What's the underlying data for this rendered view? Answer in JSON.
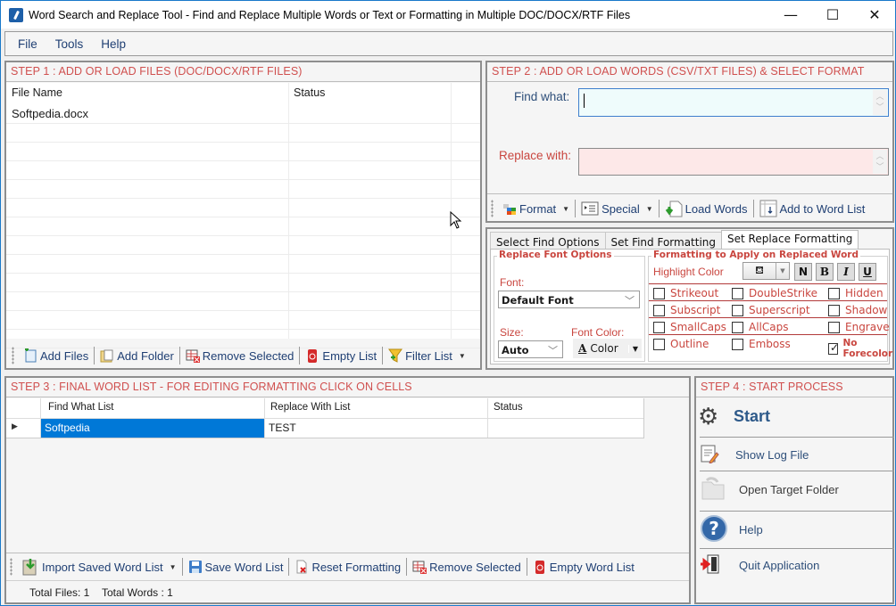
{
  "window": {
    "title": "Word Search and Replace Tool - Find and Replace Multiple Words or Text  or Formatting in Multiple DOC/DOCX/RTF Files",
    "controls": {
      "minimize": "—",
      "maximize": "☐",
      "close": "✕"
    }
  },
  "menu": [
    "File",
    "Tools",
    "Help"
  ],
  "step1": {
    "title": "STEP 1 : ADD OR LOAD FILES (DOC/DOCX/RTF FILES)",
    "columns": [
      "File Name",
      "Status"
    ],
    "rows": [
      {
        "file_name": "Softpedia.docx",
        "status": ""
      }
    ],
    "toolbar": [
      "Add Files",
      "Add Folder",
      "Remove Selected",
      "Empty List",
      "Filter List"
    ]
  },
  "step2": {
    "title": "STEP 2 : ADD OR LOAD WORDS (CSV/TXT FILES) & SELECT FORMAT",
    "find_label": "Find what:",
    "find_value": "",
    "replace_label": "Replace with:",
    "replace_value": "",
    "toolbar": [
      "Format",
      "Special",
      "Load Words",
      "Add to Word List"
    ]
  },
  "format_tabs": {
    "tabs": [
      "Select Find Options",
      "Set Find Formatting",
      "Set Replace Formatting"
    ],
    "active": "Set Replace Formatting",
    "font_group_title": "Replace Font Options",
    "font_label": "Font:",
    "font_value": "Default Font",
    "size_label": "Size:",
    "size_value": "Auto",
    "font_color_label": "Font Color:",
    "font_color_button": "Color",
    "format_group_title": "Formatting to Apply on Replaced Word",
    "highlight_label": "Highlight Color",
    "style_buttons": [
      "N",
      "B",
      "I",
      "U"
    ],
    "checkboxes": [
      {
        "label": "Strikeout",
        "checked": false
      },
      {
        "label": "DoubleStrike",
        "checked": false
      },
      {
        "label": "Hidden",
        "checked": false
      },
      {
        "label": "Subscript",
        "checked": false
      },
      {
        "label": "Superscript",
        "checked": false
      },
      {
        "label": "Shadow",
        "checked": false
      },
      {
        "label": "SmallCaps",
        "checked": false
      },
      {
        "label": "AllCaps",
        "checked": false
      },
      {
        "label": "Engrave",
        "checked": false
      },
      {
        "label": "Outline",
        "checked": false
      },
      {
        "label": "Emboss",
        "checked": false
      },
      {
        "label": "No Forecolor",
        "checked": true
      }
    ]
  },
  "step3": {
    "title": "STEP 3 : FINAL WORD LIST - FOR EDITING FORMATTING CLICK ON CELLS",
    "columns": [
      "Find What List",
      "Replace With List",
      "Status"
    ],
    "rows": [
      {
        "find": "Softpedia",
        "replace": "TEST",
        "status": ""
      }
    ],
    "toolbar": [
      "Import Saved Word List",
      "Save Word List",
      "Reset Formatting",
      "Remove Selected",
      "Empty Word List"
    ],
    "status_bar": {
      "total_files": "Total Files: 1",
      "total_words": "Total Words : 1"
    }
  },
  "step4": {
    "title": "STEP 4 : START PROCESS",
    "items": [
      "Start",
      "Show Log File",
      "Open Target Folder",
      "Help",
      "Quit Application"
    ]
  },
  "colors": {
    "accent_red": "#d0504f",
    "selection_blue": "#0078d7",
    "link_blue": "#1f3f73"
  }
}
